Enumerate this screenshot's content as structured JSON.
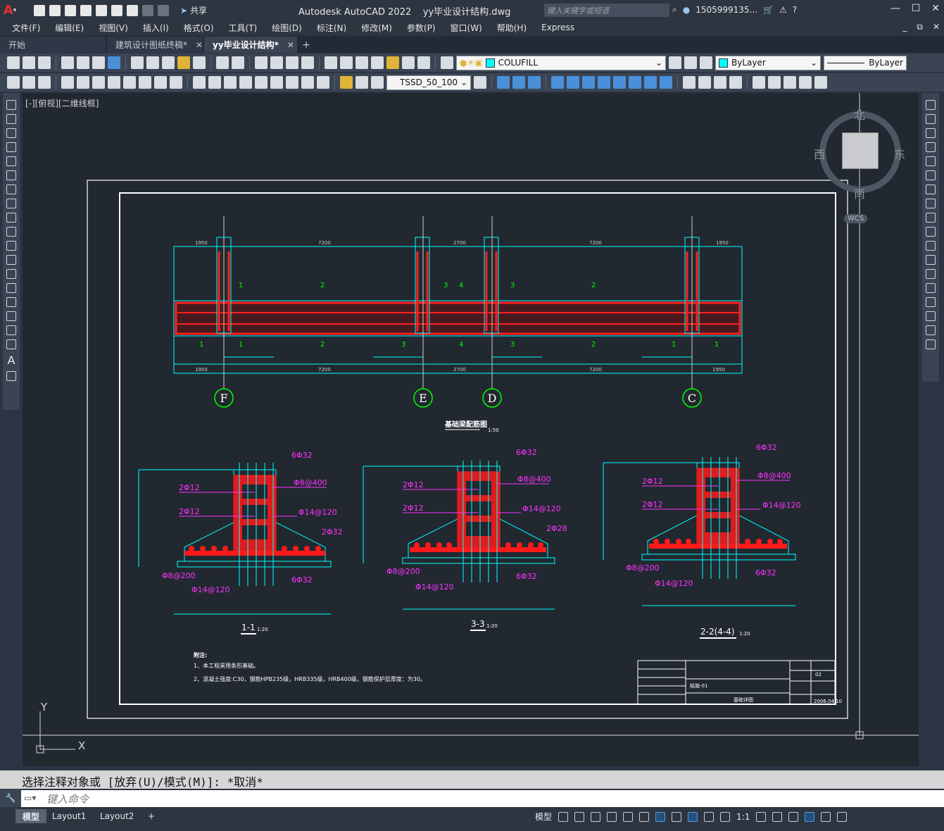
{
  "app": {
    "title": "Autodesk AutoCAD 2022",
    "filename": "yy毕业设计结构.dwg",
    "search_placeholder": "键入关键字或短语",
    "user": "1505999135...",
    "share_label": "共享"
  },
  "menu": [
    "文件(F)",
    "编辑(E)",
    "视图(V)",
    "插入(I)",
    "格式(O)",
    "工具(T)",
    "绘图(D)",
    "标注(N)",
    "修改(M)",
    "参数(P)",
    "窗口(W)",
    "帮助(H)",
    "Express"
  ],
  "file_tabs": [
    {
      "label": "开始",
      "active": false,
      "closable": false
    },
    {
      "label": "建筑设计图纸终稿*",
      "active": false,
      "closable": true
    },
    {
      "label": "yy毕业设计结构*",
      "active": true,
      "closable": true
    }
  ],
  "toolbar": {
    "layer": "COLUFILL",
    "color": "ByLayer",
    "linetype": "ByLayer",
    "dimstyle": "TSSD_50_100",
    "colors": {
      "layer_swatch": "#00ffff"
    }
  },
  "viewport": {
    "label": "[-][俯视][二维线框]",
    "viewcube": {
      "n": "北",
      "s": "南",
      "e": "东",
      "w": "西",
      "wcs": "WCS"
    },
    "ucs": {
      "x": "X",
      "y": "Y"
    }
  },
  "drawing": {
    "axes": [
      "F",
      "E",
      "D",
      "C"
    ],
    "plan_title": "基础梁配筋图",
    "plan_scale": "1:50",
    "dims_top": [
      "1950",
      "7200",
      "2700",
      "7200",
      "1950"
    ],
    "dims_bottom": [
      "1950",
      "7200",
      "2700",
      "7200",
      "1950"
    ],
    "sections": [
      {
        "title": "1-1",
        "scale": "1:20",
        "labels": [
          "6Φ32",
          "2Φ12",
          "Φ8@400",
          "2Φ12",
          "Φ14@120",
          "2Φ32",
          "Φ8@200",
          "Φ14@120",
          "6Φ32"
        ]
      },
      {
        "title": "3-3",
        "scale": "1:20",
        "labels": [
          "6Φ32",
          "2Φ12",
          "Φ8@400",
          "2Φ12",
          "Φ14@120",
          "2Φ28",
          "Φ8@200",
          "Φ14@120",
          "6Φ32"
        ]
      },
      {
        "title": "2-2(4-4)",
        "scale": "1:20",
        "labels": [
          "6Φ32",
          "2Φ12",
          "Φ8@400",
          "2Φ12",
          "Φ14@120",
          "Φ8@200",
          "Φ14@120",
          "6Φ32"
        ]
      }
    ],
    "notes_title": "附注:",
    "notes": [
      "1、本工程采用条形基础。",
      "2、混凝土强度:C30，钢筋HPB235级，HRB335级，HRB400级，钢筋保护层厚度：为30。"
    ],
    "titleblock": {
      "drawing_name": "基础详图",
      "sheet": "结施-01",
      "number": "02",
      "date": "2006.04.10"
    }
  },
  "command": {
    "history": "选择注释对象或 [放弃(U)/模式(M)]: *取消*",
    "placeholder": "键入命令"
  },
  "layout_tabs": [
    "模型",
    "Layout1",
    "Layout2"
  ],
  "status": {
    "model": "模型",
    "scale": "1:1"
  }
}
